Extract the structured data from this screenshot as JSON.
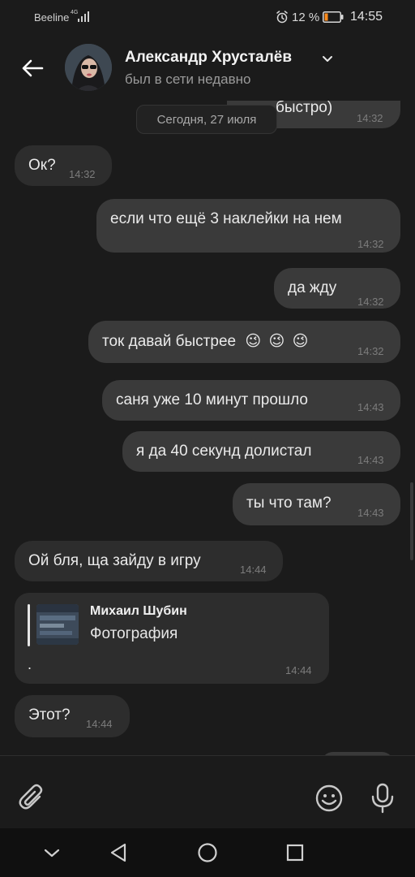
{
  "status_bar": {
    "carrier": "Beeline",
    "network_badge": "4G",
    "battery_percent": "12 %",
    "time": "14:55",
    "icons": [
      "signal-icon",
      "alarm-icon",
      "battery-icon"
    ]
  },
  "header": {
    "contact_name": "Александр Хрусталёв",
    "status": "был в сети недавно",
    "icons": [
      "back-arrow-icon",
      "chevron-down-icon"
    ]
  },
  "chat": {
    "date_separator": "Сегодня, 27 июля",
    "partial_message": {
      "text": "быстро)",
      "time": "14:32"
    },
    "messages": [
      {
        "direction": "in",
        "text": "Ок?",
        "time": "14:32"
      },
      {
        "direction": "out",
        "text": "если что ещё 3 наклейки на нем",
        "time": "14:32"
      },
      {
        "direction": "out",
        "text": "да жду",
        "time": "14:32"
      },
      {
        "direction": "out",
        "text": "ток давай быстрее",
        "emoji": [
          "😉",
          "😉",
          "😉"
        ],
        "time": "14:32"
      },
      {
        "direction": "out",
        "text": "саня уже 10 минут прошло",
        "time": "14:43"
      },
      {
        "direction": "out",
        "text": "я да 40 секунд долистал",
        "time": "14:43"
      },
      {
        "direction": "out",
        "text": "ты что там?",
        "time": "14:43"
      },
      {
        "direction": "in",
        "text": "Ой бля, ща зайду в игру",
        "time": "14:44"
      },
      {
        "direction": "in",
        "type": "forward",
        "author": "Михаил Шубин",
        "attachment": "Фотография",
        "text": ".",
        "time": "14:44"
      },
      {
        "direction": "in",
        "text": "Этот?",
        "time": "14:44"
      }
    ]
  },
  "composer": {
    "icons": [
      "paperclip-icon",
      "emoji-icon",
      "microphone-icon"
    ]
  },
  "navbar": {
    "icons": [
      "collapse-chevron-icon",
      "back-triangle-icon",
      "home-circle-icon",
      "recents-square-icon"
    ]
  },
  "colors": {
    "background": "#1b1b1b",
    "bubble_incoming": "#2d2d2d",
    "bubble_outgoing": "#3a3a3a",
    "timestamp": "#7c7c7c",
    "navbar": "#101010"
  }
}
